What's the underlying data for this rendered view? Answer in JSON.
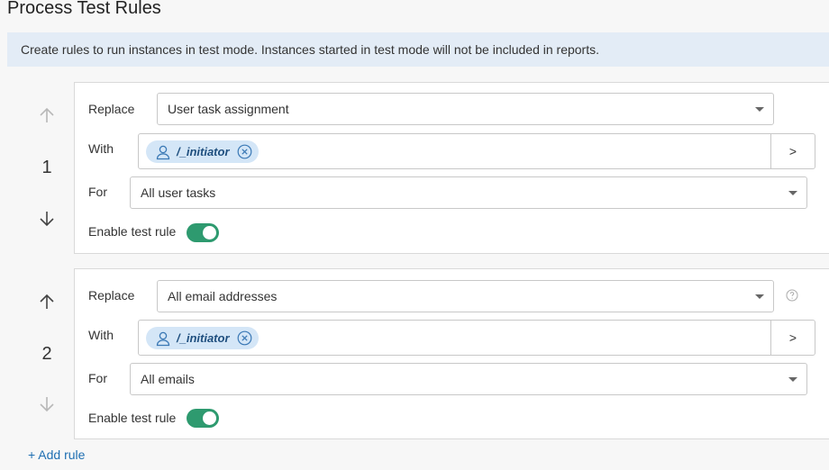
{
  "title": "Process Test Rules",
  "info": "Create rules to run instances in test mode. Instances started in test mode will not be included in reports.",
  "labels": {
    "replace": "Replace",
    "with": "With",
    "for": "For",
    "enable": "Enable test rule",
    "picker": ">"
  },
  "rules": [
    {
      "number": "1",
      "replace_value": "User task assignment",
      "with_chip": "/_initiator",
      "for_value": "All user tasks",
      "enabled": true,
      "up_enabled": false,
      "down_enabled": true
    },
    {
      "number": "2",
      "replace_value": "All email addresses",
      "with_chip": "/_initiator",
      "for_value": "All emails",
      "enabled": true,
      "up_enabled": true,
      "down_enabled": false
    }
  ],
  "add_rule": "+ Add rule",
  "colors": {
    "banner": "#e3ecf6",
    "toggle_on": "#2e9a6f",
    "chip": "#d4e6f7",
    "link": "#1f6fb2"
  }
}
